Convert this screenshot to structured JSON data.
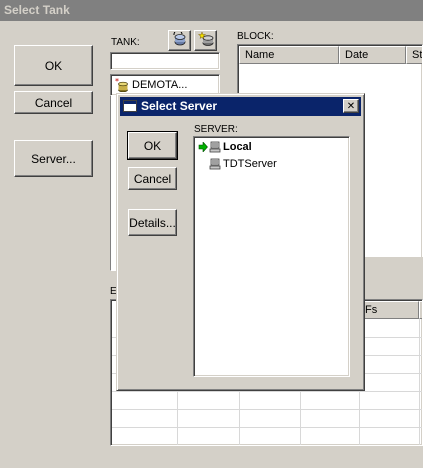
{
  "window": {
    "title": "Select Tank"
  },
  "main": {
    "ok_label": "OK",
    "cancel_label": "Cancel",
    "server_label": "Server..."
  },
  "tank": {
    "label": "TANK:",
    "item": "DEMOTA..."
  },
  "block": {
    "label": "BLOCK:",
    "columns": [
      "Name",
      "Date",
      "St"
    ]
  },
  "events": {
    "label": "E",
    "column_fs": "Fs"
  },
  "dialog": {
    "title": "Select Server",
    "ok_label": "OK",
    "cancel_label": "Cancel",
    "details_label": "Details...",
    "server_label": "SERVER:",
    "servers": [
      "Local",
      "TDTServer"
    ],
    "selected_server": "Local",
    "close_glyph": "✕"
  }
}
